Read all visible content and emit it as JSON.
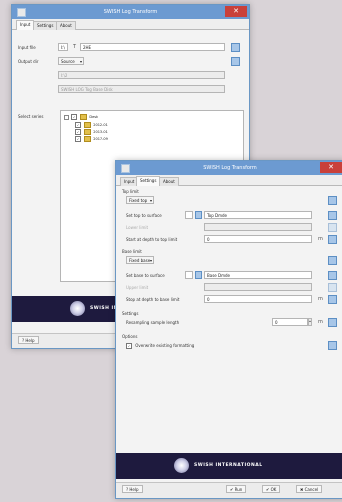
{
  "window": {
    "title": "SWISH Log Transform",
    "close": "✕"
  },
  "tabs": [
    "Input",
    "Settings",
    "About"
  ],
  "input_tab": {
    "input_file_label": "Input file",
    "input_file_value": "I:\\",
    "input_file_name": "2HE",
    "output_dir_label": "Output dir",
    "output_dir_value": "Source",
    "path_value": "I:\\2",
    "path_value2": "SWISH LOG Tog Base Disk",
    "source_label": "Select series",
    "tree_root": "Desk",
    "tree_items": [
      "2012-01",
      "2013-01",
      "2017-09"
    ]
  },
  "settings_tab": {
    "top_limit_group": "Top limit",
    "top_limit_select": "Fixed top",
    "top_surface_label": "Set top to surface",
    "top_surface_value": "Top Dmde",
    "lower_limit_label": "Lower limit",
    "top_depth_label": "Start at depth to top limit",
    "top_depth_value": "0",
    "base_limit_group": "Base limit",
    "base_limit_select": "Fixed base",
    "base_surface_label": "Set base to surface",
    "base_surface_value": "Base Dmde",
    "upper_limit_label": "Upper limit",
    "base_depth_label": "Stop at depth to base limit",
    "base_depth_value": "0",
    "settings_group": "Settings",
    "resampling_label": "Resampling sample length",
    "resampling_value": "0",
    "options_group": "Options",
    "option_label": "Overwrite existing formatting"
  },
  "banner": {
    "text": "SWISH INTERNATIONAL"
  },
  "bottom_buttons": {
    "help": "Help",
    "run": "Run",
    "ok": "OK",
    "cancel": "Cancel"
  },
  "colors": {
    "title_bar": "#6c9ad1",
    "close_button": "#c9403a",
    "banner": "#1e1a3e",
    "background": "#d9d3d7"
  }
}
